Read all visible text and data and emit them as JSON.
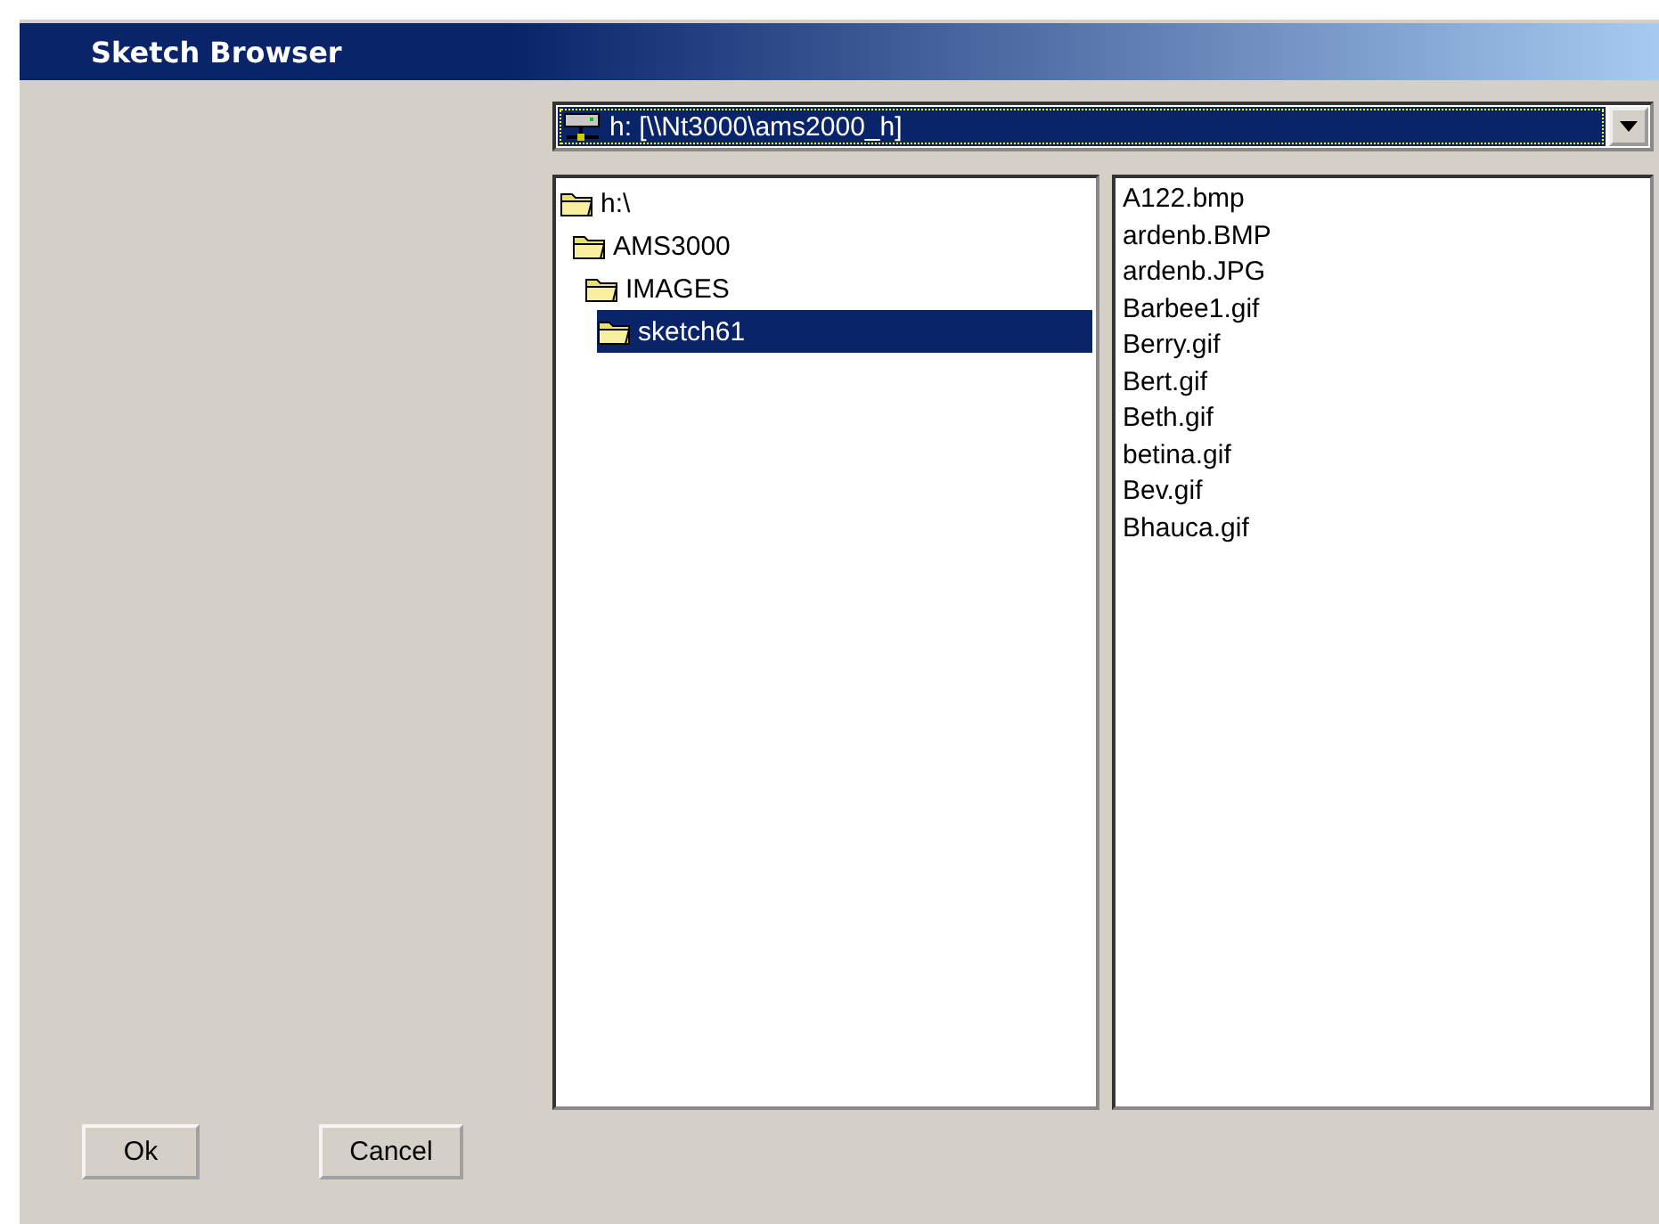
{
  "window": {
    "title": "Sketch Browser"
  },
  "drive": {
    "value": "h: [\\\\Nt3000\\ams2000_h]"
  },
  "folders": [
    {
      "label": "h:\\",
      "selected": false,
      "children": [
        {
          "label": "AMS3000",
          "selected": false,
          "children": [
            {
              "label": "IMAGES",
              "selected": false,
              "children": [
                {
                  "label": "sketch61",
                  "selected": true
                }
              ]
            }
          ]
        }
      ]
    }
  ],
  "files": [
    {
      "label": "A122.bmp",
      "selected": false
    },
    {
      "label": "ardenb.BMP",
      "selected": false
    },
    {
      "label": "ardenb.JPG",
      "selected": false
    },
    {
      "label": "Barbee1.gif",
      "selected": false
    },
    {
      "label": "Berry.gif",
      "selected": false
    },
    {
      "label": "Bert.gif",
      "selected": false
    },
    {
      "label": "Beth.gif",
      "selected": false
    },
    {
      "label": "betina.gif",
      "selected": false
    },
    {
      "label": "Bev.gif",
      "selected": false
    },
    {
      "label": "Bhauca.gif",
      "selected": false
    }
  ],
  "buttons": [
    "Ok",
    "Cancel"
  ]
}
